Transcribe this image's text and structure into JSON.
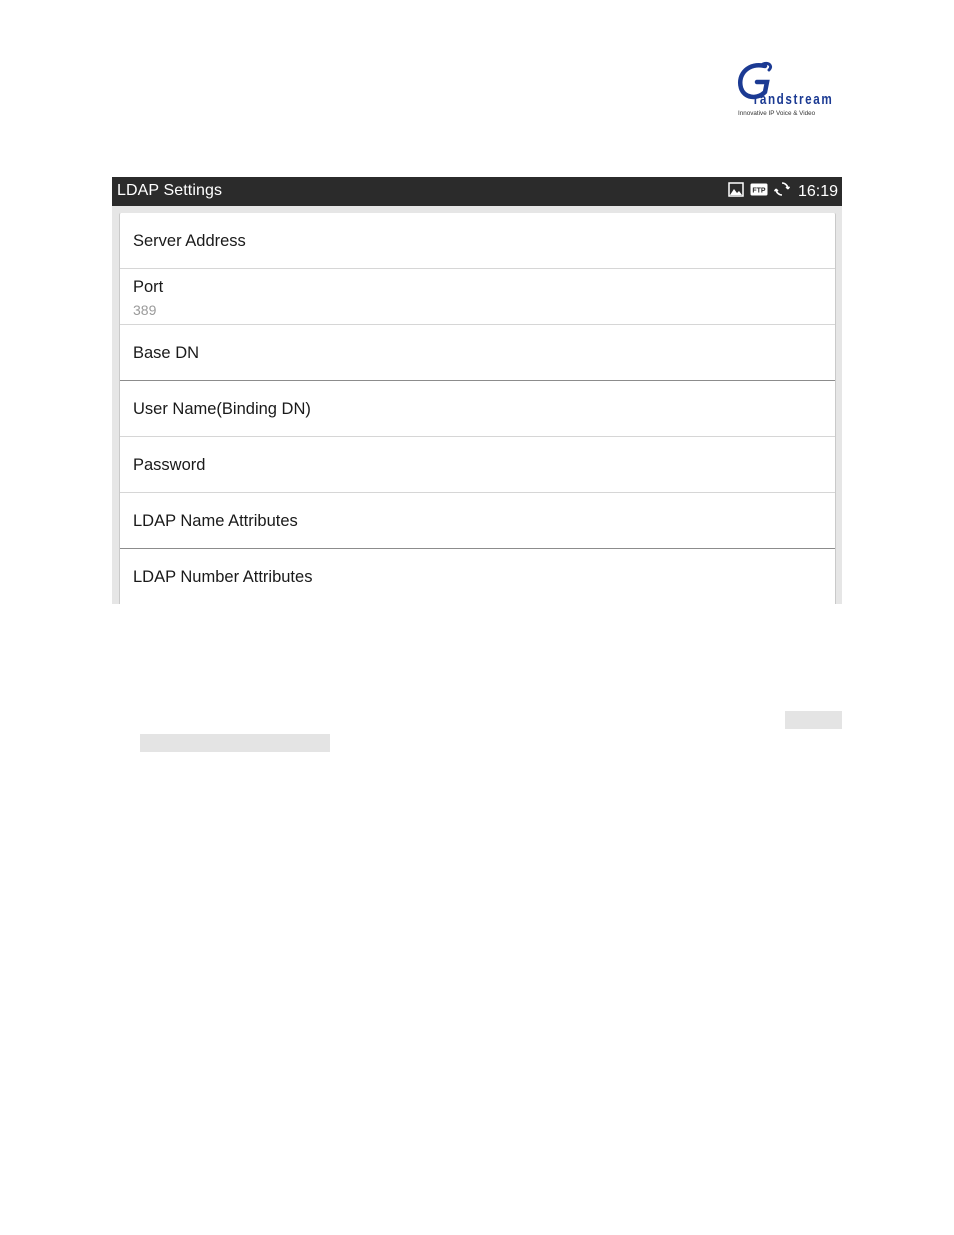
{
  "logo": {
    "brand": "Grandstream",
    "tagline": "Innovative IP Voice & Video"
  },
  "statusbar": {
    "title": "LDAP Settings",
    "icons": [
      "image-icon",
      "ftp-icon",
      "sync-icon"
    ],
    "ftp_label": "FTP",
    "time": "16:19"
  },
  "settings": {
    "server_address": {
      "label": "Server Address"
    },
    "port": {
      "label": "Port",
      "value": "389"
    },
    "base_dn": {
      "label": "Base DN"
    },
    "user_name": {
      "label": "User Name(Binding DN)"
    },
    "password": {
      "label": "Password"
    },
    "name_attributes": {
      "label": "LDAP Name Attributes"
    },
    "number_attributes": {
      "label": "LDAP Number Attributes"
    }
  },
  "colors": {
    "statusbar_bg": "#2b2b2b",
    "screen_bg": "#e6e6e6",
    "brand_blue": "#1b3a93"
  }
}
